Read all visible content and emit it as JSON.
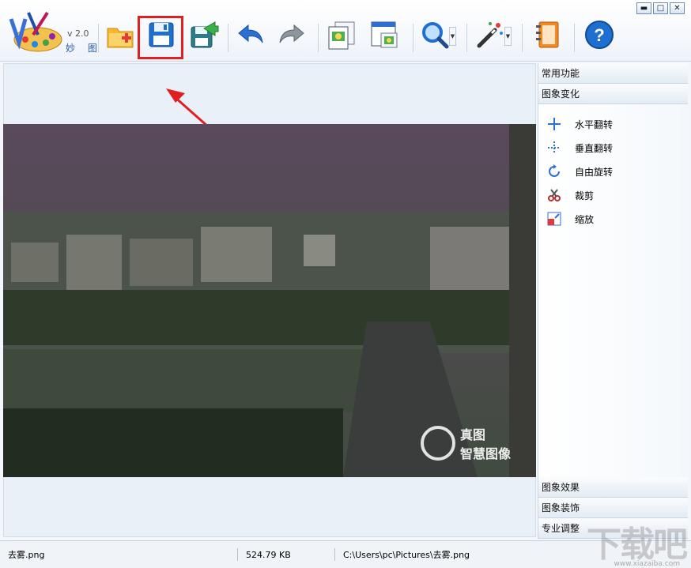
{
  "app": {
    "version": "v 2.0",
    "name": "妙 图"
  },
  "window_controls": {
    "minimize": "▬",
    "maximize": "□",
    "close": "✕"
  },
  "toolbar": {
    "buttons": [
      {
        "name": "open",
        "icon": "folder-plus-icon"
      },
      {
        "name": "save",
        "icon": "floppy-disk-icon",
        "highlighted": true
      },
      {
        "name": "save-as",
        "icon": "save-as-icon"
      },
      {
        "name": "undo",
        "icon": "undo-arrow-icon"
      },
      {
        "name": "redo",
        "icon": "redo-arrow-icon"
      },
      {
        "name": "copy",
        "icon": "copy-image-icon"
      },
      {
        "name": "window",
        "icon": "window-image-icon"
      },
      {
        "name": "zoom",
        "icon": "magnifier-icon"
      },
      {
        "name": "magic",
        "icon": "magic-wand-icon"
      },
      {
        "name": "book",
        "icon": "notebook-icon"
      },
      {
        "name": "help",
        "icon": "help-icon"
      }
    ]
  },
  "panel": {
    "header_common": "常用功能",
    "header_transform": "图象变化",
    "items": [
      {
        "label": "水平翻转",
        "icon": "flip-horizontal-icon"
      },
      {
        "label": "垂直翻转",
        "icon": "flip-vertical-icon"
      },
      {
        "label": "自由旋转",
        "icon": "rotate-icon"
      },
      {
        "label": "裁剪",
        "icon": "scissors-icon"
      },
      {
        "label": "缩放",
        "icon": "resize-icon"
      }
    ],
    "bottom_headers": [
      "图象效果",
      "图象装饰",
      "专业调整"
    ]
  },
  "image": {
    "watermark_line1": "真图",
    "watermark_line2": "智慧图像"
  },
  "status": {
    "filename": "去雾.png",
    "filesize": "524.79 KB",
    "path": "C:\\Users\\pc\\Pictures\\去雾.png"
  },
  "site_watermark": {
    "text": "下载吧",
    "url": "www.xiazaiba.com"
  },
  "colors": {
    "highlight": "#e02020",
    "accent_blue": "#2a6fd6"
  }
}
